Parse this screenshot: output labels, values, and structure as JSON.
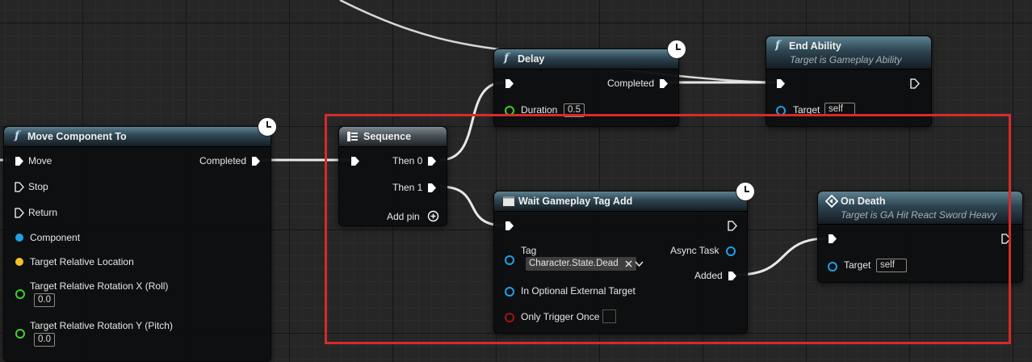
{
  "nodes": {
    "move_component_to": {
      "title": "Move Component To",
      "icon": "function-icon",
      "out_completed": "Completed",
      "pins": [
        "Move",
        "Stop",
        "Return",
        "Component",
        "Target Relative Location",
        "Target Relative Rotation X (Roll)",
        "Target Relative Rotation Y (Pitch)"
      ],
      "rot_x_value": "0.0",
      "rot_y_value": "0.0"
    },
    "sequence": {
      "title": "Sequence",
      "then0": "Then 0",
      "then1": "Then 1",
      "add_pin": "Add pin"
    },
    "delay": {
      "title": "Delay",
      "completed": "Completed",
      "duration_label": "Duration",
      "duration_value": "0.5"
    },
    "end_ability": {
      "title": "End Ability",
      "subtitle": "Target is Gameplay Ability",
      "target_label": "Target",
      "target_value": "self"
    },
    "wait_tag": {
      "title": "Wait Gameplay Tag Add",
      "tag_label": "Tag",
      "tag_value": "Character.State.Dead",
      "async_task": "Async Task",
      "added": "Added",
      "optional_target": "In Optional External Target",
      "only_once": "Only Trigger Once"
    },
    "on_death": {
      "title": "On Death",
      "subtitle": "Target is GA Hit React Sword Heavy",
      "target_label": "Target",
      "target_value": "self"
    }
  },
  "colors": {
    "exec": "#ffffff",
    "object_pin": "#1ea0e8",
    "vector_pin": "#f4c22a",
    "float_pin": "#3fcf2f",
    "bool_pin": "#a01414",
    "highlight": "#d62b2b"
  }
}
